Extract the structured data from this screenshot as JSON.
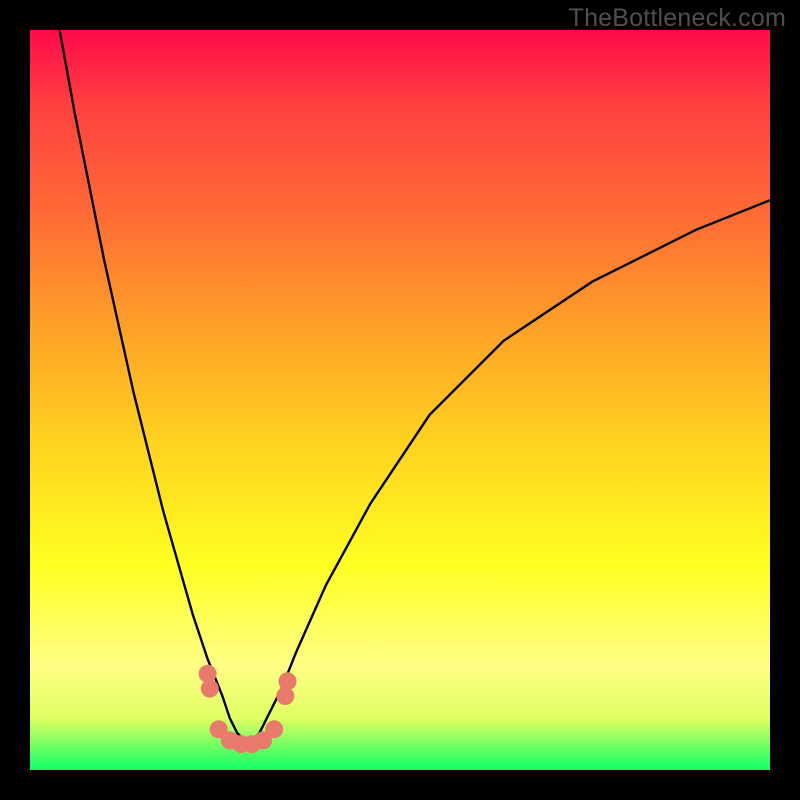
{
  "watermark": "TheBottleneck.com",
  "chart_data": {
    "type": "line",
    "title": "",
    "xlabel": "",
    "ylabel": "",
    "xlim": [
      0,
      100
    ],
    "ylim": [
      0,
      100
    ],
    "series": [
      {
        "name": "bottleneck-v-curve",
        "x": [
          4,
          6,
          8,
          10,
          12,
          14,
          16,
          18,
          20,
          22,
          24,
          26,
          27,
          28,
          29,
          30,
          31,
          32,
          34,
          36,
          40,
          46,
          54,
          64,
          76,
          90,
          100
        ],
        "y": [
          100,
          89,
          79,
          69,
          60,
          51,
          43,
          35,
          28,
          21,
          15,
          10,
          7,
          5,
          4,
          4,
          5,
          7,
          11,
          16,
          25,
          36,
          48,
          58,
          66,
          73,
          77
        ]
      }
    ],
    "markers": {
      "name": "highlight-dots",
      "color": "#e77a6b",
      "points": [
        {
          "x": 24.0,
          "y": 13
        },
        {
          "x": 24.3,
          "y": 11
        },
        {
          "x": 25.5,
          "y": 5.5
        },
        {
          "x": 27.0,
          "y": 4.0
        },
        {
          "x": 28.5,
          "y": 3.5
        },
        {
          "x": 30.0,
          "y": 3.5
        },
        {
          "x": 31.5,
          "y": 4.0
        },
        {
          "x": 33.0,
          "y": 5.5
        },
        {
          "x": 34.5,
          "y": 10
        },
        {
          "x": 34.8,
          "y": 12
        }
      ]
    },
    "background": "rainbow-vertical-gradient",
    "grid": false
  }
}
